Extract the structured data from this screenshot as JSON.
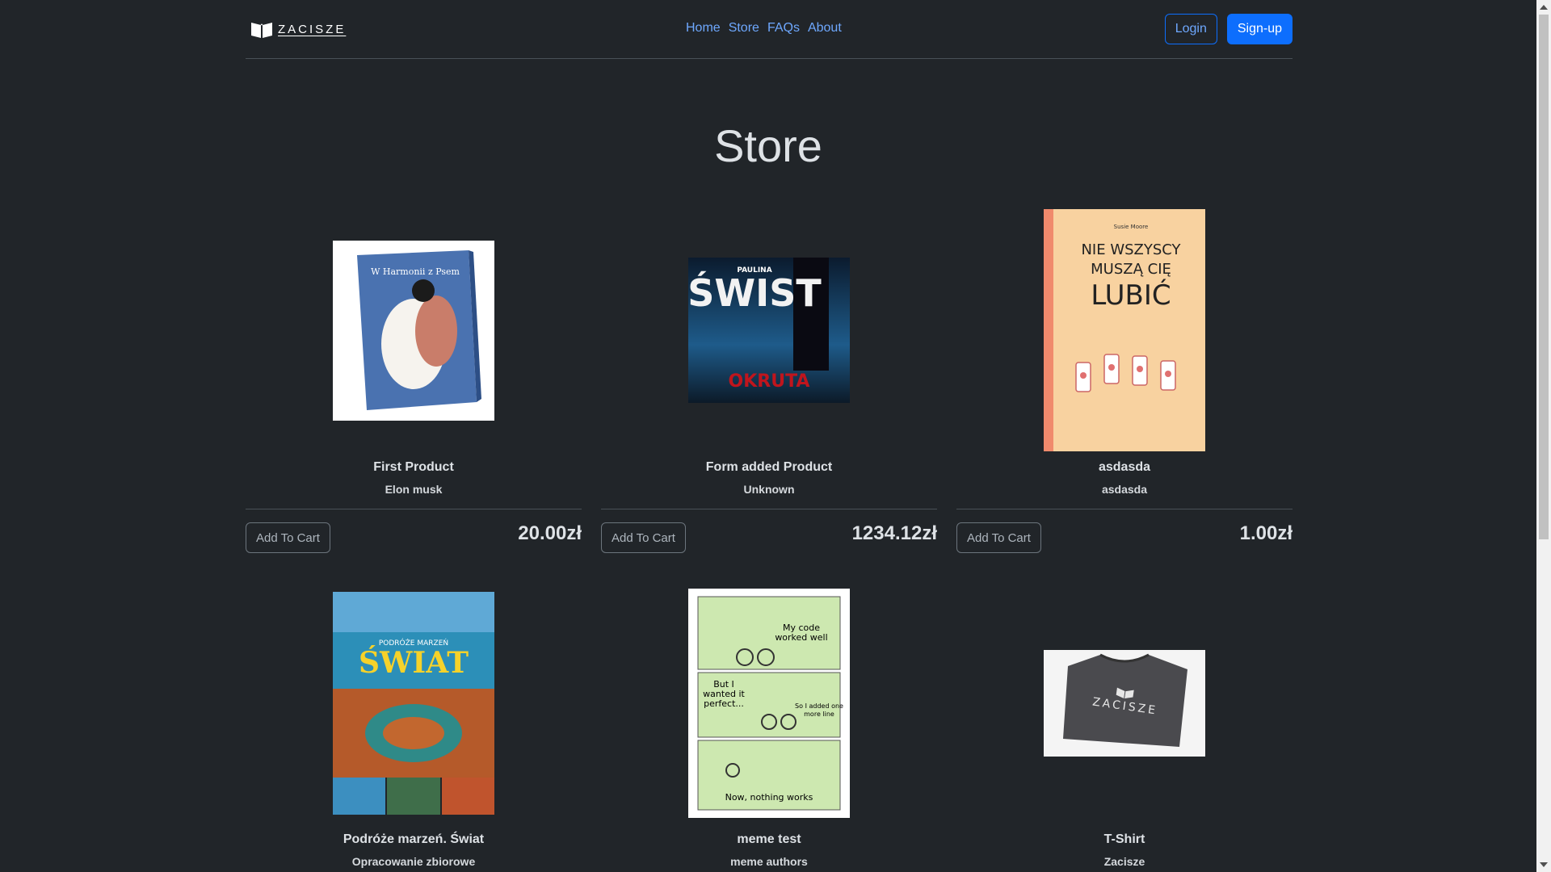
{
  "brand": {
    "name": "ZACISZE",
    "logo_icon": "open-book-icon"
  },
  "nav": {
    "items": [
      "Home",
      "Store",
      "FAQs",
      "About"
    ]
  },
  "auth": {
    "login": "Login",
    "signup": "Sign-up"
  },
  "colors": {
    "background": "#212529",
    "accent": "#0d6efd",
    "link": "#6ea8fe"
  },
  "page": {
    "title": "Store"
  },
  "products": [
    {
      "title": "First Product",
      "author": "Elon musk",
      "price": "20.00zł",
      "button": "Add To Cart",
      "cover_text": "W Harmonii z Psem"
    },
    {
      "title": "Form added Product",
      "author": "Unknown",
      "price": "1234.12zł",
      "button": "Add To Cart",
      "cover_text": "PAULINA ŚWIST OKRUTA"
    },
    {
      "title": "asdasda",
      "author": "asdasda",
      "price": "1.00zł",
      "button": "Add To Cart",
      "cover_text": "NIE WSZYSCY MUSZĄ CIĘ LUBIĆ"
    },
    {
      "title": "Podróże marzeń. Świat",
      "author": "Opracowanie zbiorowe",
      "cover_text": "PODRÓŻE MARZEŃ ŚWIAT"
    },
    {
      "title": "meme test",
      "author": "meme authors",
      "cover_text": "My code worked well / But I wanted it perfect... / So I added one more line / Now, nothing works"
    },
    {
      "title": "T-Shirt",
      "author": "Zacisze",
      "cover_text": "ZACISZE"
    }
  ]
}
